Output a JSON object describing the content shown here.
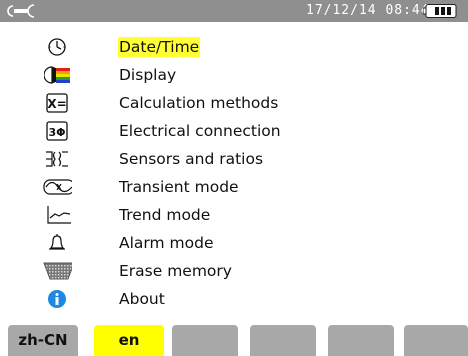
{
  "status_bar": {
    "datetime": "17/12/14 08:44",
    "bar_color": "#8f8f8f"
  },
  "menu": {
    "items": [
      {
        "label": "Date/Time",
        "icon": "clock-icon",
        "selected": true
      },
      {
        "label": "Display",
        "icon": "display-icon"
      },
      {
        "label": "Calculation methods",
        "icon": "calculation-icon"
      },
      {
        "label": "Electrical connection",
        "icon": "three-phase-icon"
      },
      {
        "label": "Sensors and ratios",
        "icon": "sensors-icon"
      },
      {
        "label": "Transient mode",
        "icon": "transient-icon"
      },
      {
        "label": "Trend mode",
        "icon": "trend-icon"
      },
      {
        "label": "Alarm mode",
        "icon": "bell-icon"
      },
      {
        "label": "Erase memory",
        "icon": "erase-icon"
      },
      {
        "label": "About",
        "icon": "info-icon"
      }
    ],
    "highlight_color": "#ffff33"
  },
  "softkeys": [
    {
      "label": "zh-CN"
    },
    {
      "label": "en",
      "active": true
    },
    {
      "label": ""
    },
    {
      "label": ""
    },
    {
      "label": ""
    },
    {
      "label": ""
    }
  ]
}
